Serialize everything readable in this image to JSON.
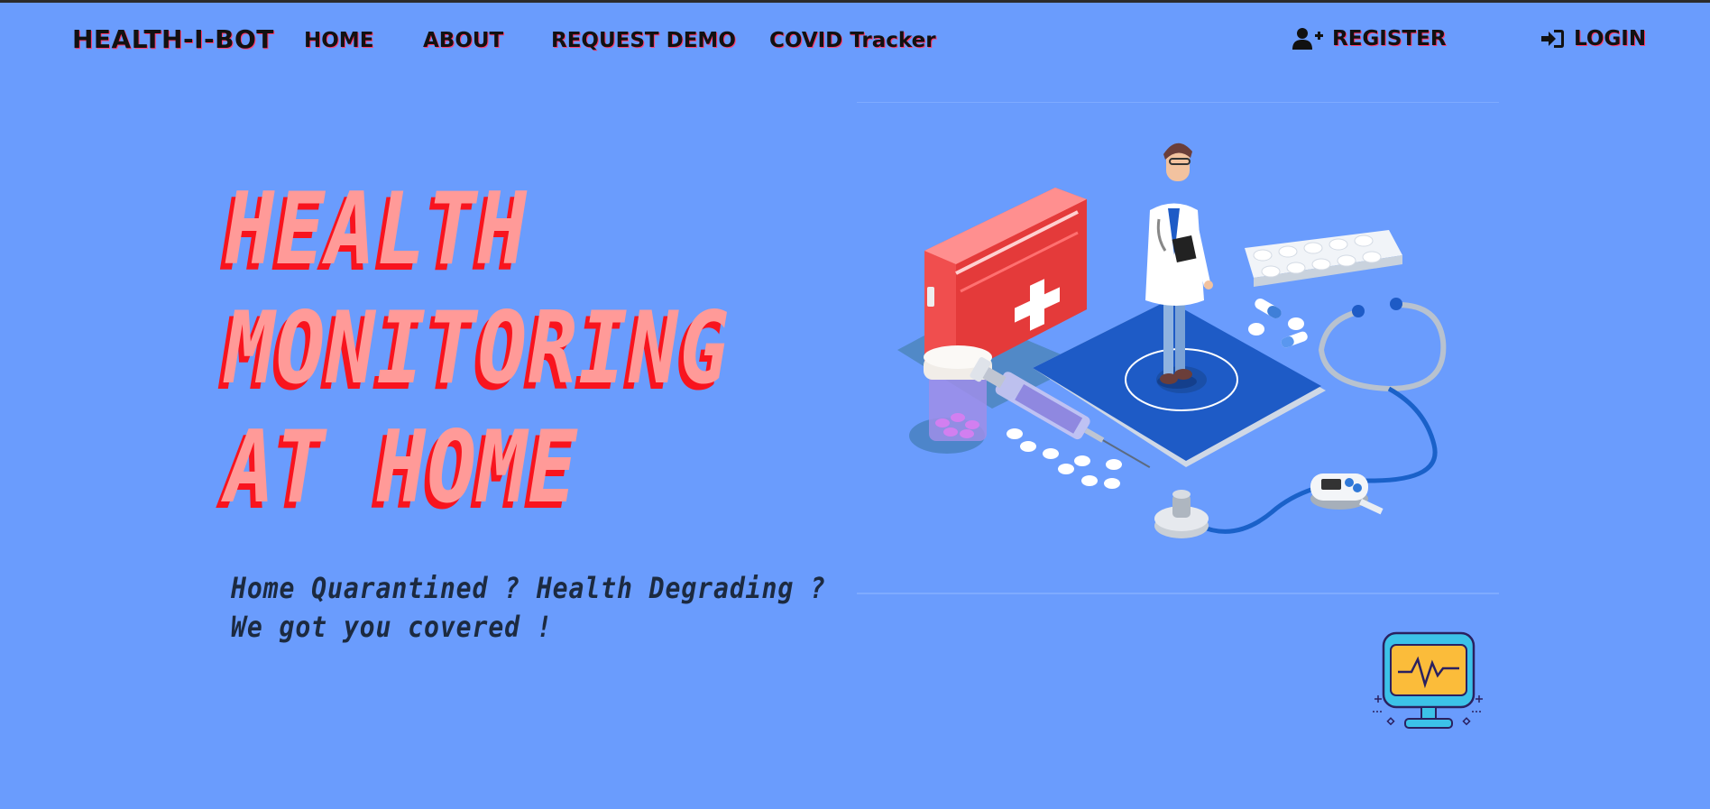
{
  "nav": {
    "brand": "HEALTH-I-BOT",
    "links": [
      {
        "label": "HOME"
      },
      {
        "label": "ABOUT"
      },
      {
        "label": "REQUEST DEMO"
      },
      {
        "label": "COVID Tracker"
      }
    ],
    "register": {
      "label": "REGISTER",
      "icon": "user-plus-icon"
    },
    "login": {
      "label": "LOGIN",
      "icon": "sign-in-icon"
    }
  },
  "hero": {
    "title_lines": [
      "HEALTH",
      "MONITORING",
      "AT HOME"
    ],
    "tagline_lines": [
      "Home Quarantined ? Health Degrading ?",
      "We got you covered !"
    ]
  },
  "colors": {
    "background": "#6a9cfd",
    "title_fill": "#ff9a98",
    "title_shadow": "#f8141e",
    "tagline": "#1c2a40",
    "nav_text": "#111111"
  },
  "images": {
    "illustration": "medical-equipment-doctor-illustration",
    "monitor": "health-monitor-icon"
  }
}
